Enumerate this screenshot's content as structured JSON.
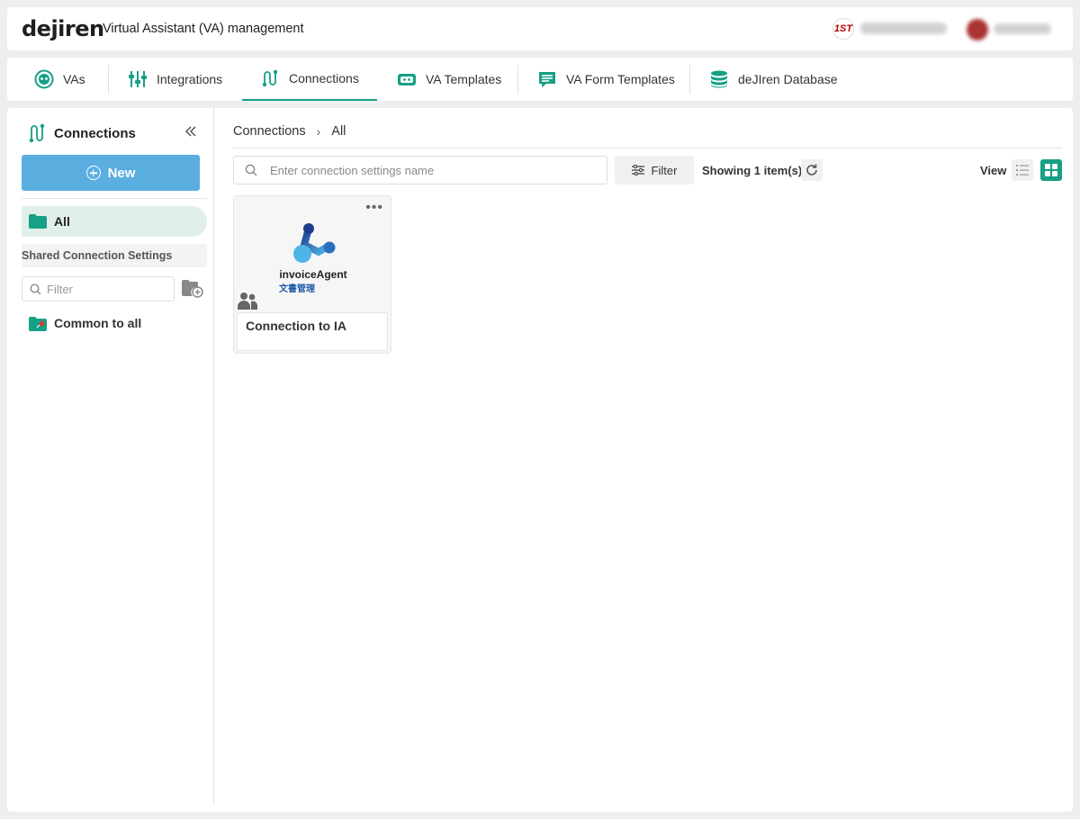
{
  "header": {
    "logo": "dejiren",
    "title": "Virtual Assistant (VA) management",
    "org_badge": "1ST"
  },
  "tabs": [
    {
      "label": "VAs",
      "icon": "va-face-icon"
    },
    {
      "label": "Integrations",
      "icon": "integrations-icon"
    },
    {
      "label": "Connections",
      "icon": "connections-icon",
      "active": true
    },
    {
      "label": "VA Templates",
      "icon": "va-template-icon"
    },
    {
      "label": "VA Form Templates",
      "icon": "form-template-icon"
    },
    {
      "label": "deJIren Database",
      "icon": "database-icon"
    }
  ],
  "sidebar": {
    "title": "Connections",
    "new_label": "New",
    "all_label": "All",
    "section_title": "Shared Connection Settings",
    "filter_placeholder": "Filter",
    "items": [
      {
        "label": "Common to all"
      }
    ]
  },
  "content": {
    "breadcrumb": [
      "Connections",
      "All"
    ],
    "search_placeholder": "Enter connection settings name",
    "filter_label": "Filter",
    "showing": "Showing 1 item(s)",
    "view_label": "View",
    "cards": [
      {
        "name": "Connection to IA",
        "brand": "invoiceAgent",
        "brand_sub": "文書管理",
        "more": "•••"
      }
    ]
  },
  "colors": {
    "accent": "#16a085",
    "new_button": "#5aaee0",
    "selected_bg": "#e0efe9"
  }
}
